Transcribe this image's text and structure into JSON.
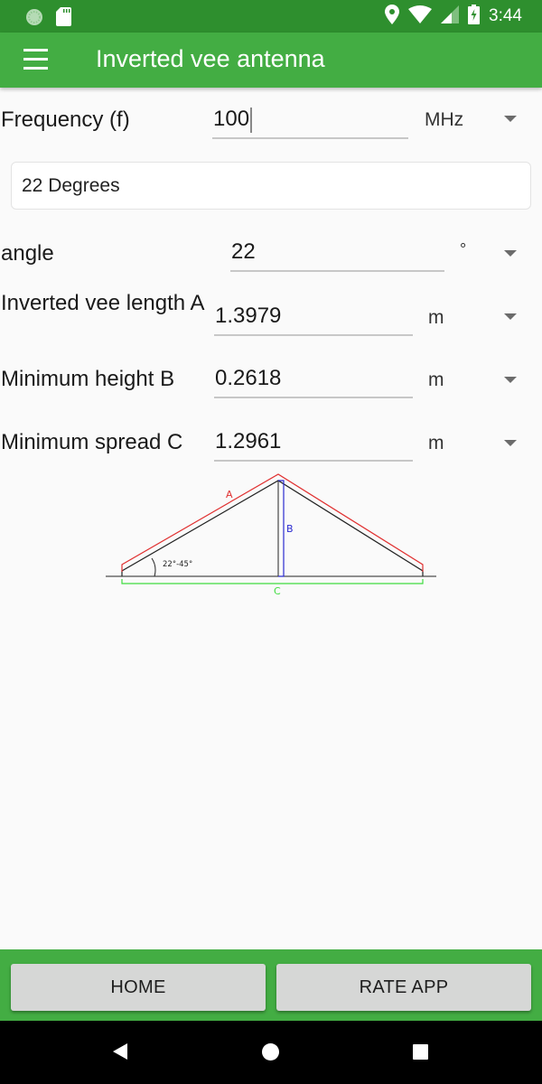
{
  "status_bar": {
    "time": "3:44",
    "left_icons": [
      "sync-icon",
      "sd-card-icon"
    ],
    "right_icons": [
      "location-icon",
      "wifi-icon",
      "signal-icon",
      "battery-charging-icon"
    ]
  },
  "app_bar": {
    "menu_icon": "hamburger-menu-icon",
    "title": "Inverted vee antenna"
  },
  "form": {
    "frequency": {
      "label": "Frequency (f)",
      "value": "100",
      "unit": "MHz"
    },
    "preset": {
      "value": "22 Degrees"
    },
    "angle": {
      "label": "angle",
      "value": "22",
      "unit": "°"
    },
    "length_a": {
      "label": "Inverted vee length A",
      "value": "1.3979",
      "unit": "m"
    },
    "height_b": {
      "label": "Minimum height B",
      "value": "0.2618",
      "unit": "m"
    },
    "spread_c": {
      "label": "Minimum spread C",
      "value": "1.2961",
      "unit": "m"
    }
  },
  "diagram": {
    "label_a": "A",
    "label_b": "B",
    "label_c": "C",
    "angle_label": "22°-45°",
    "colors": {
      "a": "#e03030",
      "b": "#2b2bd0",
      "c": "#3fdc3f",
      "wire": "#222222"
    }
  },
  "bottom_bar": {
    "home_label": "HOME",
    "rate_label": "RATE APP"
  },
  "nav_bar": {
    "icons": [
      "back-icon",
      "home-icon",
      "recents-icon"
    ]
  },
  "theme": {
    "primary": "#43ad43",
    "primary_dark": "#2e8f2e"
  }
}
